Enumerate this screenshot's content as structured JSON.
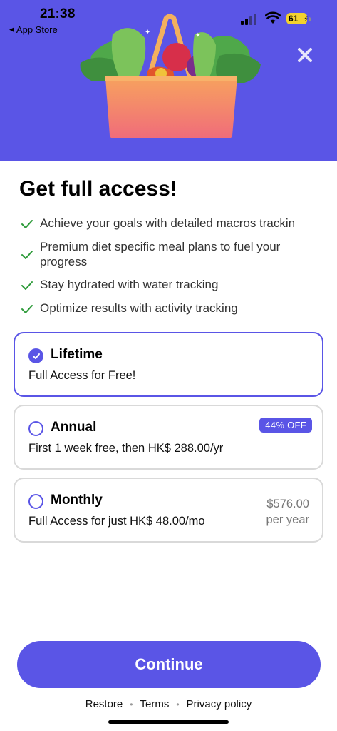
{
  "status_bar": {
    "time": "21:38",
    "back_app": "App Store",
    "back_arrow": "◀",
    "battery": "61"
  },
  "colors": {
    "accent": "#5a55e6",
    "check_green": "#2e9b3a",
    "border_gray": "#d9d9d9"
  },
  "hero": {
    "image": "grocery-bag-illustration",
    "close_icon": "close-icon"
  },
  "title": "Get full access!",
  "features": [
    "Achieve your goals with detailed macros trackin",
    "Premium diet specific meal plans to fuel your progress",
    "Stay hydrated with water tracking",
    "Optimize results with activity tracking"
  ],
  "plans": {
    "lifetime": {
      "name": "Lifetime",
      "description": "Full Access for Free!",
      "selected": true
    },
    "annual": {
      "name": "Annual",
      "description": "First 1 week free, then HK$ 288.00/yr",
      "badge": "44% OFF",
      "selected": false
    },
    "monthly": {
      "name": "Monthly",
      "description": "Full Access for just HK$ 48.00/mo",
      "yearly_price": "$576.00",
      "yearly_suffix": "per year",
      "selected": false
    }
  },
  "continue_label": "Continue",
  "footer": {
    "restore": "Restore",
    "terms": "Terms",
    "privacy": "Privacy policy",
    "separator": "•"
  }
}
